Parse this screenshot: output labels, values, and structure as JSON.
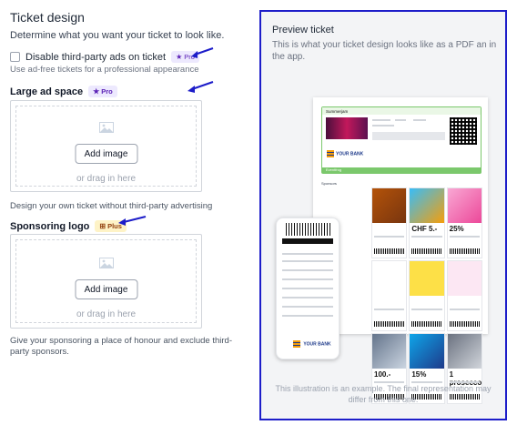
{
  "settings": {
    "title": "Ticket design",
    "description": "Determine what you want your ticket to look like.",
    "disable_ads": {
      "label": "Disable third-party ads on ticket",
      "badge": "Pro",
      "hint": "Use ad-free tickets for a professional appearance",
      "checked": false
    },
    "large_ad_space": {
      "label": "Large ad space",
      "badge": "Pro",
      "button": "Add image",
      "drag_text": "or drag in here",
      "help": "Design your own ticket without third-party advertising"
    },
    "sponsoring_logo": {
      "label": "Sponsoring logo",
      "badge": "Plus",
      "button": "Add image",
      "drag_text": "or drag in here",
      "help": "Give your sponsoring a place of honour and exclude third-party sponsors."
    }
  },
  "preview": {
    "title": "Preview ticket",
    "description": "This is what your ticket design looks like as a PDF an in the app.",
    "footnote": "This illustration is an example. The final representation may differ from this one.",
    "illustration": {
      "ticket_event": "Summerjam",
      "ticket_brand": "YOUR BANK",
      "ticket_footer": "Eventfrog",
      "sponsors_label": "Sponsors",
      "ads": [
        "",
        "CHF 5.-",
        "25%",
        "",
        "",
        "",
        "100.-",
        "15%",
        "1 prosecco"
      ],
      "phone_brand": "YOUR BANK"
    }
  },
  "colors": {
    "pro_badge_bg": "#ede9fe",
    "pro_badge_fg": "#5b21b6",
    "plus_badge_bg": "#fef3c7",
    "plus_badge_fg": "#92400e",
    "annotation_arrow": "#1d1dc9",
    "preview_border": "#1d1dc9"
  }
}
